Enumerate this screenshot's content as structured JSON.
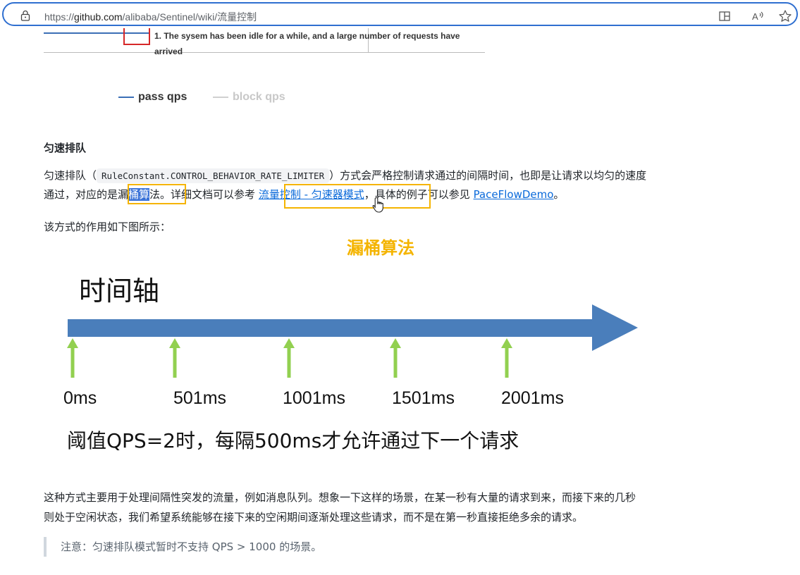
{
  "browser": {
    "url_prefix": "https://",
    "url_host": "github.com",
    "url_path": "/alibaba/Sentinel/wiki/流量控制"
  },
  "top_chart": {
    "note": "1. The sysem has been idle for a while, and a large number of requests have",
    "note_cont": "arrived",
    "legend": [
      {
        "label": "pass qps",
        "color": "#3b6fb6"
      },
      {
        "label": "block qps",
        "color": "#d0d0d0"
      }
    ]
  },
  "section": {
    "heading": "匀速排队",
    "p1_a": "匀速排队（",
    "p1_code": "RuleConstant.CONTROL_BEHAVIOR_RATE_LIMITER",
    "p1_b": "）方式会严格控制请求通过的间隔时间，也即是让请求以均匀的速度",
    "p2_a": "通过，对应的是",
    "p2_b": "漏",
    "p2_sel": "桶算",
    "p2_c": "法。详细文档可以参考 ",
    "p2_link1": "流量控制 - 匀速器模式",
    "p2_d": "，具体的例子可以参见 ",
    "p2_link2": "PaceFlowDemo",
    "p2_e": "。",
    "p3": "该方式的作用如下图所示：",
    "annotation": "漏桶算法"
  },
  "timeline": {
    "title": "时间轴",
    "ticks": [
      "0ms",
      "501ms",
      "1001ms",
      "1501ms",
      "2001ms"
    ],
    "caption": "阈值QPS=2时，每隔500ms才允许通过下一个请求",
    "arrow_color": "#4a7ebb",
    "tick_color": "#92d050"
  },
  "bottom": {
    "p1": "这种方式主要用于处理间隔性突发的流量，例如消息队列。想象一下这样的场景，在某一秒有大量的请求到来，而接下来的几秒",
    "p2": "则处于空闲状态，我们希望系统能够在接下来的空闲期间逐渐处理这些请求，而不是在第一秒直接拒绝多余的请求。",
    "note": "注意：匀速排队模式暂时不支持 QPS > 1000 的场景。"
  }
}
